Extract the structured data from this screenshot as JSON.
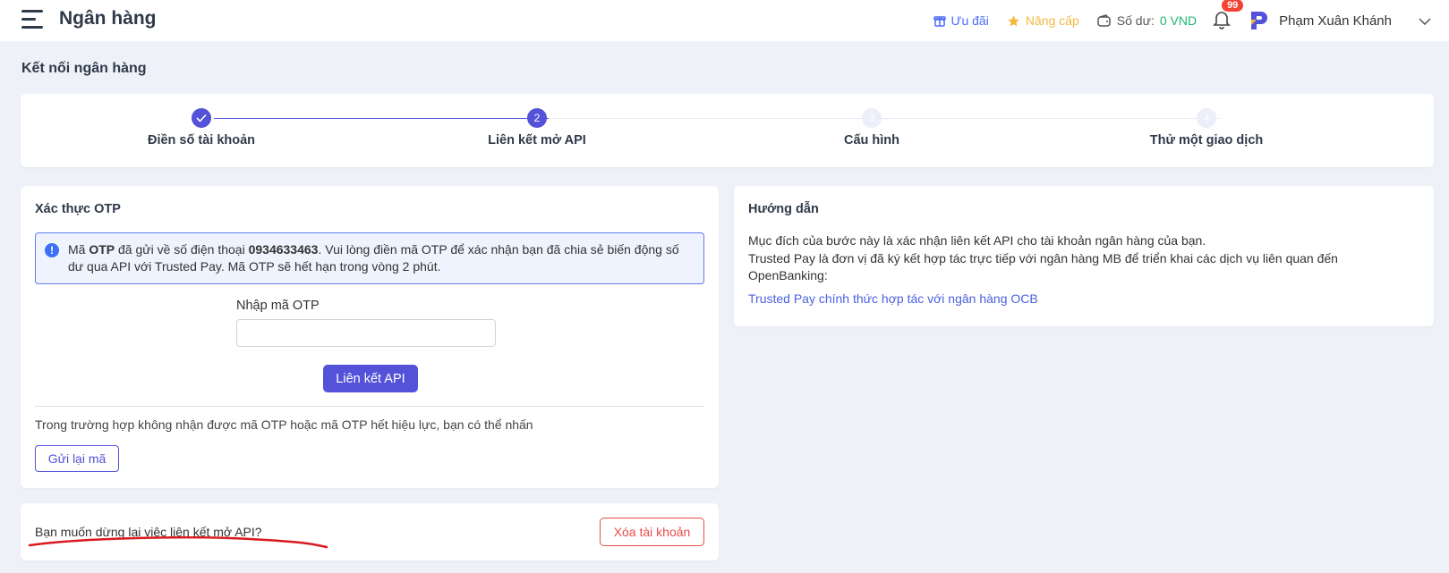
{
  "header": {
    "app_title": "Ngân hàng",
    "promo_label": "Ưu đãi",
    "upgrade_label": "Nâng cấp",
    "balance_label": "Số dư:",
    "balance_value": "0 VND",
    "notification_count": "99",
    "user_name": "Phạm Xuân Khánh",
    "icons": [
      "menu-icon",
      "gift-icon",
      "star-icon",
      "wallet-icon",
      "bell-icon",
      "brand-logo-icon",
      "chevron-down-icon"
    ],
    "colors": {
      "promo": "#4a6cf7",
      "upgrade": "#f4b740",
      "balance": "#22b573",
      "badge": "#f44336"
    }
  },
  "page": {
    "title": "Kết nối ngân hàng"
  },
  "steps": [
    {
      "label": "Điền số tài khoản",
      "number": "",
      "status": "done"
    },
    {
      "label": "Liên kết mở API",
      "number": "2",
      "status": "active"
    },
    {
      "label": "Cấu hình",
      "number": "3",
      "status": "todo"
    },
    {
      "label": "Thử một giao dịch",
      "number": "4",
      "status": "todo"
    }
  ],
  "otp": {
    "title": "Xác thực OTP",
    "alert_prefix": "Mã ",
    "alert_otp": "OTP",
    "alert_mid": " đã gửi về số điện thoại ",
    "alert_phone": "0934633463",
    "alert_suffix": ". Vui lòng điền mã OTP để xác nhận bạn đã chia sẻ biến động số dư qua API với Trusted Pay. Mã OTP sẽ hết hạn trong vòng 2 phút.",
    "input_label": "Nhập mã OTP",
    "input_value": "",
    "submit_label": "Liên kết API",
    "resend_text": "Trong trường hợp không nhận được mã OTP hoặc mã OTP hết hiệu lực, bạn có thể nhấn",
    "resend_label": "Gửi lại mã"
  },
  "guide": {
    "title": "Hướng dẫn",
    "line1": "Mục đích của bước này là xác nhận liên kết API cho tài khoản ngân hàng của bạn.",
    "line2": "Trusted Pay là đơn vị đã ký kết hợp tác trực tiếp với ngân hàng MB để triển khai các dịch vụ liên quan đến OpenBanking:",
    "link_label": "Trusted Pay chính thức hợp tác với ngân hàng OCB"
  },
  "stop": {
    "question": "Bạn muốn dừng lại việc liên kết mở API?",
    "delete_label": "Xóa tài khoản"
  },
  "accent_color": "#5352d8"
}
